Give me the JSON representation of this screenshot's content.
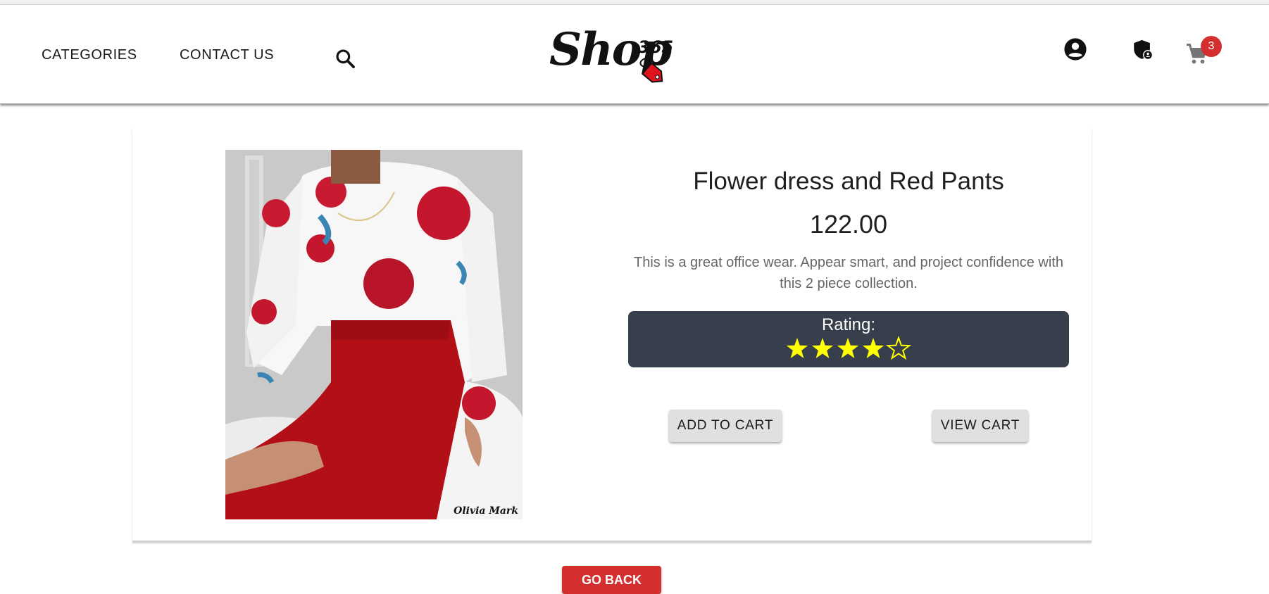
{
  "header": {
    "nav": [
      {
        "label": "CATEGORIES"
      },
      {
        "label": "CONTACT US"
      }
    ],
    "logo": {
      "text": "Shop",
      "number": "365"
    },
    "cart_count": "3"
  },
  "product": {
    "title": "Flower dress and Red Pants",
    "price": "122.00",
    "description": "This is a great office wear. Appear smart, and project confidence with this 2 piece collection.",
    "rating_label": "Rating:",
    "rating": 4,
    "rating_max": 5,
    "image_watermark": "Olivia Mark"
  },
  "actions": {
    "add_to_cart": "ADD TO CART",
    "view_cart": "VIEW CART",
    "go_back": "GO BACK"
  },
  "colors": {
    "accent_red": "#d32f2f",
    "rating_bg": "#373e4c",
    "star": "#ffff00"
  },
  "icons": [
    "search-icon",
    "account-circle-icon",
    "admin-shield-icon",
    "cart-icon",
    "star-icon",
    "star-outline-icon"
  ]
}
